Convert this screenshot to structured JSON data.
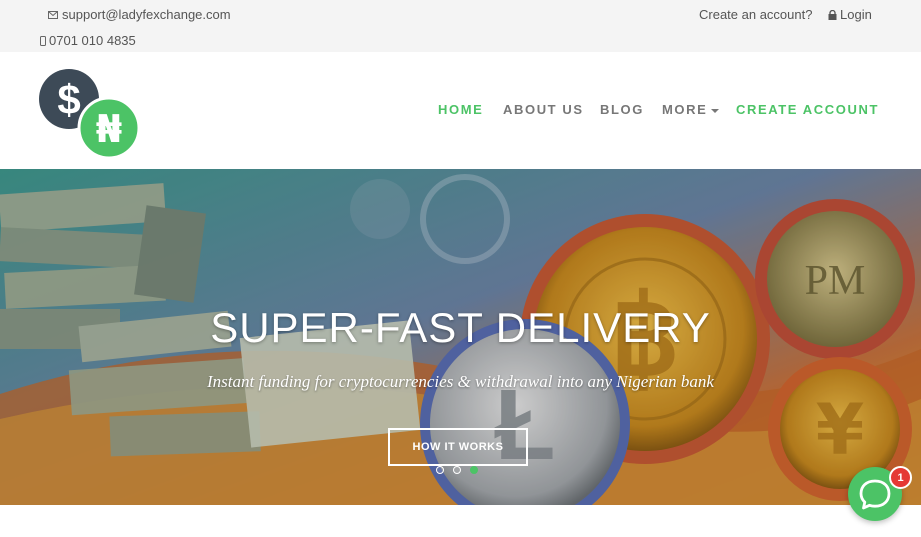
{
  "topbar": {
    "email": "support@ladyfexchange.com",
    "phone": "0701 010 4835",
    "create_account": "Create an account?",
    "login": "Login"
  },
  "nav": {
    "home": "HOME",
    "about": "ABOUT US",
    "blog": "BLOG",
    "more": "MORE",
    "create": "CREATE ACCOUNT"
  },
  "logo": {
    "dollar": "$",
    "naira": "₦"
  },
  "hero": {
    "title": "SUPER-FAST DELIVERY",
    "subtitle": "Instant funding for cryptocurrencies & withdrawal into any Nigerian bank",
    "button": "HOW IT WORKS",
    "slides": 3,
    "active_slide": 3
  },
  "chat": {
    "badge": "1"
  },
  "colors": {
    "accent": "#4cc366",
    "logo_dark": "#3d4a57",
    "badge": "#e53935"
  }
}
